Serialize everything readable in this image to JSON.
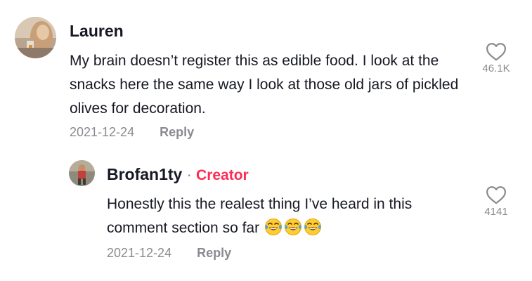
{
  "comments": [
    {
      "username": "Lauren",
      "text": "My brain doesn’t register this as edible food. I look at the snacks here the same way I look at those old jars of pickled olives for decoration.",
      "date": "2021-12-24",
      "reply_label": "Reply",
      "like_count": "46.1K",
      "avatar_icon": "user-photo-avatar",
      "like_icon": "heart-outline-icon"
    }
  ],
  "reply": {
    "username": "Brofan1ty",
    "separator": "·",
    "badge": "Creator",
    "text": "Honestly this the realest thing I’ve heard in this comment section so far",
    "emojis": [
      "😂",
      "😂",
      "😂"
    ],
    "date": "2021-12-24",
    "reply_label": "Reply",
    "like_count": "4141",
    "avatar_icon": "user-photo-avatar",
    "like_icon": "heart-outline-icon"
  },
  "colors": {
    "text_primary": "#161823",
    "text_secondary": "#8a8b91",
    "creator_accent": "#fe2c55"
  }
}
